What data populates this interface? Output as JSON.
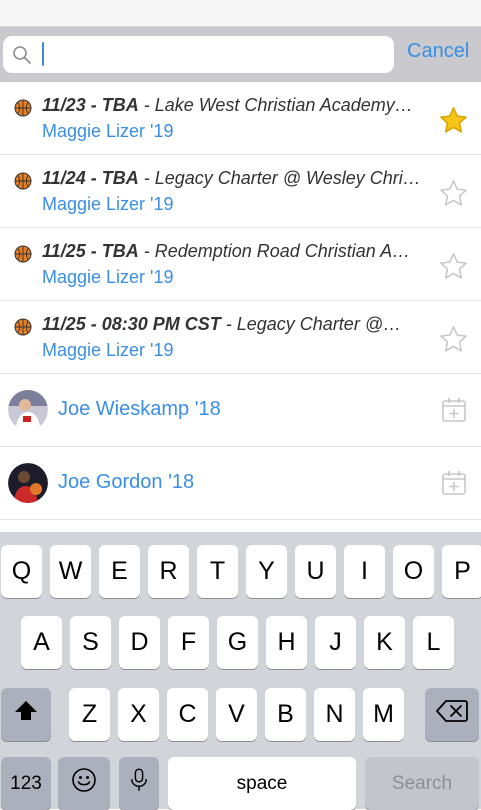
{
  "search": {
    "value": "",
    "cancel_label": "Cancel"
  },
  "games": [
    {
      "datetime": "11/23 - TBA",
      "title": "Lake West Christian Academy…",
      "player": "Maggie Lizer '19",
      "starred": true
    },
    {
      "datetime": "11/24 - TBA",
      "title": "Legacy Charter @ Wesley Chri…",
      "player": "Maggie Lizer '19",
      "starred": false
    },
    {
      "datetime": "11/25 - TBA",
      "title": "Redemption Road Christian A…",
      "player": "Maggie Lizer '19",
      "starred": false
    },
    {
      "datetime": "11/25 - 08:30 PM CST",
      "title": "Legacy Charter @…",
      "player": "Maggie Lizer '19",
      "starred": false
    }
  ],
  "players": [
    {
      "name": "Joe Wieskamp '18"
    },
    {
      "name": "Joe Gordon '18"
    }
  ],
  "keyboard": {
    "row1": [
      "Q",
      "W",
      "E",
      "R",
      "T",
      "Y",
      "U",
      "I",
      "O",
      "P"
    ],
    "row2": [
      "A",
      "S",
      "D",
      "F",
      "G",
      "H",
      "J",
      "K",
      "L"
    ],
    "row3": [
      "Z",
      "X",
      "C",
      "V",
      "B",
      "N",
      "M"
    ],
    "numbers_label": "123",
    "space_label": "space",
    "return_label": "Search"
  },
  "colors": {
    "accent": "#3a8ee6",
    "star_filled": "#f5c518",
    "star_outline": "#c7c7cc",
    "keyboard_bg": "#d1d4d9"
  }
}
